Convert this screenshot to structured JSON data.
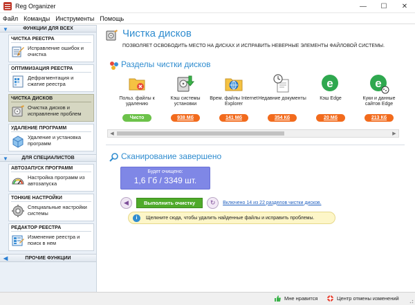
{
  "window": {
    "title": "Reg Organizer",
    "controls": [
      "—",
      "☐",
      "✕"
    ]
  },
  "menu": [
    "Файл",
    "Команды",
    "Инструменты",
    "Помощь"
  ],
  "sidebar": {
    "section_all": "ФУНКЦИИ ДЛЯ ВСЕХ",
    "items_all": [
      {
        "title": "ЧИСТКА РЕЕСТРА",
        "desc": "Исправление ошибок и очистка",
        "icon": "registry-cleanup-icon"
      },
      {
        "title": "ОПТИМИЗАЦИЯ РЕЕСТРА",
        "desc": "Дефрагментация и сжатие реестра",
        "icon": "registry-optimize-icon"
      },
      {
        "title": "ЧИСТКА ДИСКОВ",
        "desc": "Очистка дисков и исправление проблем",
        "icon": "disk-cleanup-icon",
        "active": true
      },
      {
        "title": "УДАЛЕНИЕ ПРОГРАММ",
        "desc": "Удаление и установка программ",
        "icon": "uninstall-icon"
      }
    ],
    "section_pro": "ДЛЯ СПЕЦИАЛИСТОВ",
    "items_pro": [
      {
        "title": "АВТОЗАПУСК ПРОГРАММ",
        "desc": "Настройка программ из автозапуска",
        "icon": "autorun-icon"
      },
      {
        "title": "ТОНКИЕ НАСТРОЙКИ",
        "desc": "Специальные настройки системы",
        "icon": "tweaks-icon"
      },
      {
        "title": "РЕДАКТОР РЕЕСТРА",
        "desc": "Изменение реестра и поиск в нем",
        "icon": "registry-editor-icon"
      }
    ],
    "section_other": "ПРОЧИЕ ФУНКЦИИ"
  },
  "main": {
    "title": "Чистка дисков",
    "subtitle": "ПОЗВОЛЯЕТ ОСВОБОДИТЬ МЕСТО НА ДИСКАХ И ИСПРАВИТЬ НЕВЕРНЫЕ ЭЛЕМЕНТЫ ФАЙЛОВОЙ СИСТЕМЫ.",
    "sections_title": "Разделы чистки дисков",
    "categories": [
      {
        "name": "Польз. файлы к удалению",
        "value": "Чисто",
        "status": "clean",
        "icon": "user-files-icon"
      },
      {
        "name": "Кэш системы установки",
        "value": "938 Мб",
        "status": "dirty",
        "icon": "installer-cache-icon"
      },
      {
        "name": "Врем. файлы Internet Explorer",
        "value": "141 Мб",
        "status": "dirty",
        "icon": "ie-temp-icon"
      },
      {
        "name": "Недавние документы",
        "value": "354 Кб",
        "status": "dirty",
        "icon": "recent-docs-icon"
      },
      {
        "name": "Кэш Edge",
        "value": "20 Мб",
        "status": "dirty",
        "icon": "edge-cache-icon"
      },
      {
        "name": "Куки и данные сайтов Edge",
        "value": "213 Кб",
        "status": "dirty",
        "icon": "edge-cookies-icon"
      }
    ],
    "scan_title": "Сканирование завершено",
    "result_label": "Будет очищено:",
    "result_value": "1,6 Гб / 3349 шт.",
    "clean_button": "Выполнить очистку",
    "link_text": "Включено 14 из 22 разделов чистки дисков.",
    "tip_text": "Щелкните сюда, чтобы удалить найденные файлы и исправить проблемы."
  },
  "status": {
    "like": "Мне нравится",
    "undo_center": "Центр отмены изменений"
  },
  "colors": {
    "accent": "#2f8ccf",
    "clean_green": "#6cc24a",
    "size_orange": "#f26b1d",
    "result_purple": "#7f87e6"
  }
}
